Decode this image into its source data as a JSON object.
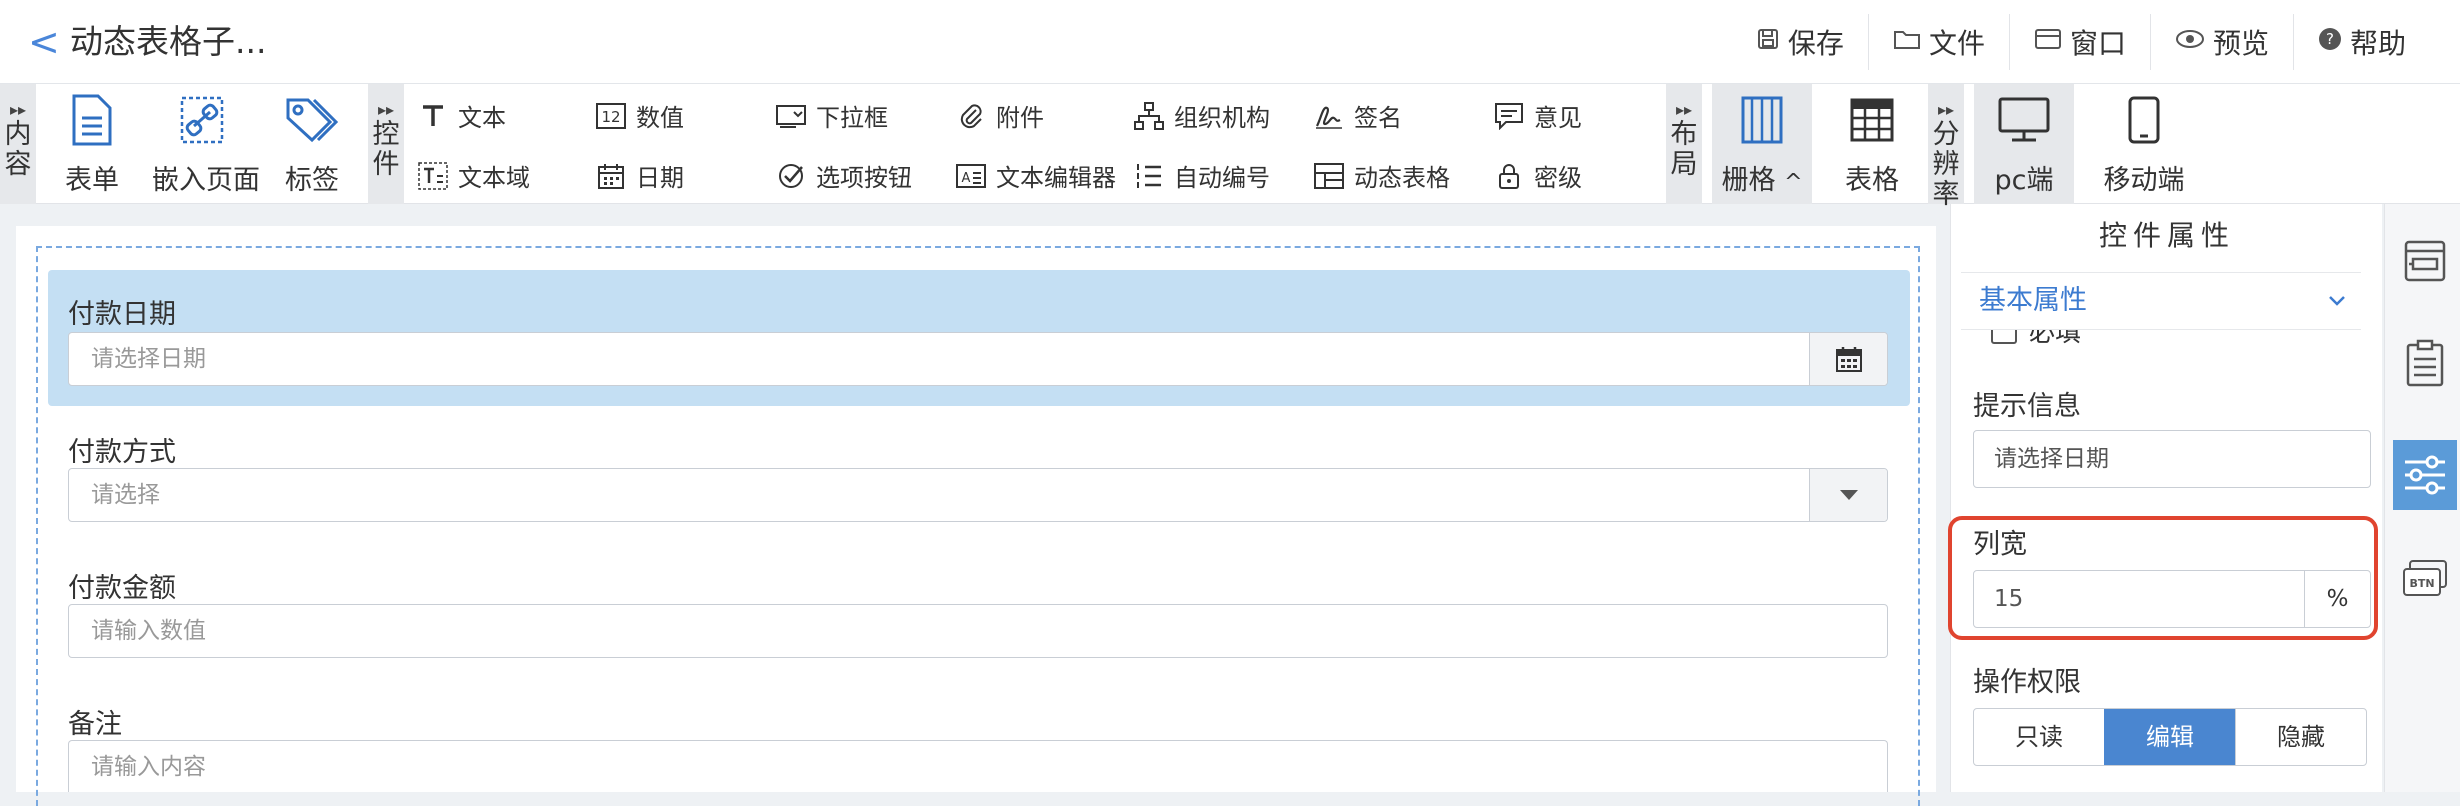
{
  "header": {
    "title": "动态表格子...",
    "actions": [
      {
        "label": "保存",
        "icon": "save-icon"
      },
      {
        "label": "文件",
        "icon": "folder-icon"
      },
      {
        "label": "窗口",
        "icon": "window-icon"
      },
      {
        "label": "预览",
        "icon": "eye-icon"
      },
      {
        "label": "帮助",
        "icon": "help-icon"
      }
    ]
  },
  "toolbar": {
    "content_group": {
      "label": "内容",
      "items": [
        "表单",
        "嵌入页面",
        "标签"
      ]
    },
    "control_group": {
      "label": "控件",
      "row1": [
        "文本",
        "数值",
        "下拉框",
        "附件",
        "组织机构",
        "签名",
        "意见"
      ],
      "row2": [
        "文本域",
        "日期",
        "选项按钮",
        "文本编辑器",
        "自动编号",
        "动态表格",
        "密级"
      ]
    },
    "layout_group": {
      "label": "布局",
      "items": [
        "栅格",
        "表格"
      ]
    },
    "resolution_group": {
      "label": "分辨率",
      "items": [
        "pc端",
        "移动端"
      ],
      "active": "pc端"
    }
  },
  "form": {
    "fields": [
      {
        "label": "付款日期",
        "placeholder": "请选择日期"
      },
      {
        "label": "付款方式",
        "placeholder": "请选择"
      },
      {
        "label": "付款金额",
        "placeholder": "请输入数值"
      },
      {
        "label": "备注",
        "placeholder": "请输入内容"
      }
    ]
  },
  "panel": {
    "title": "控件属性",
    "section": "基本属性",
    "required_label": "必填",
    "hint_label": "提示信息",
    "hint_value": "请选择日期",
    "width_label": "列宽",
    "width_value": "15",
    "width_unit": "%",
    "perm_label": "操作权限",
    "perm_options": [
      "只读",
      "编辑",
      "隐藏"
    ],
    "perm_selected": "编辑"
  },
  "colors": {
    "accent": "#4a86d0",
    "highlight": "#c4dff3",
    "callout": "#e0442f"
  }
}
